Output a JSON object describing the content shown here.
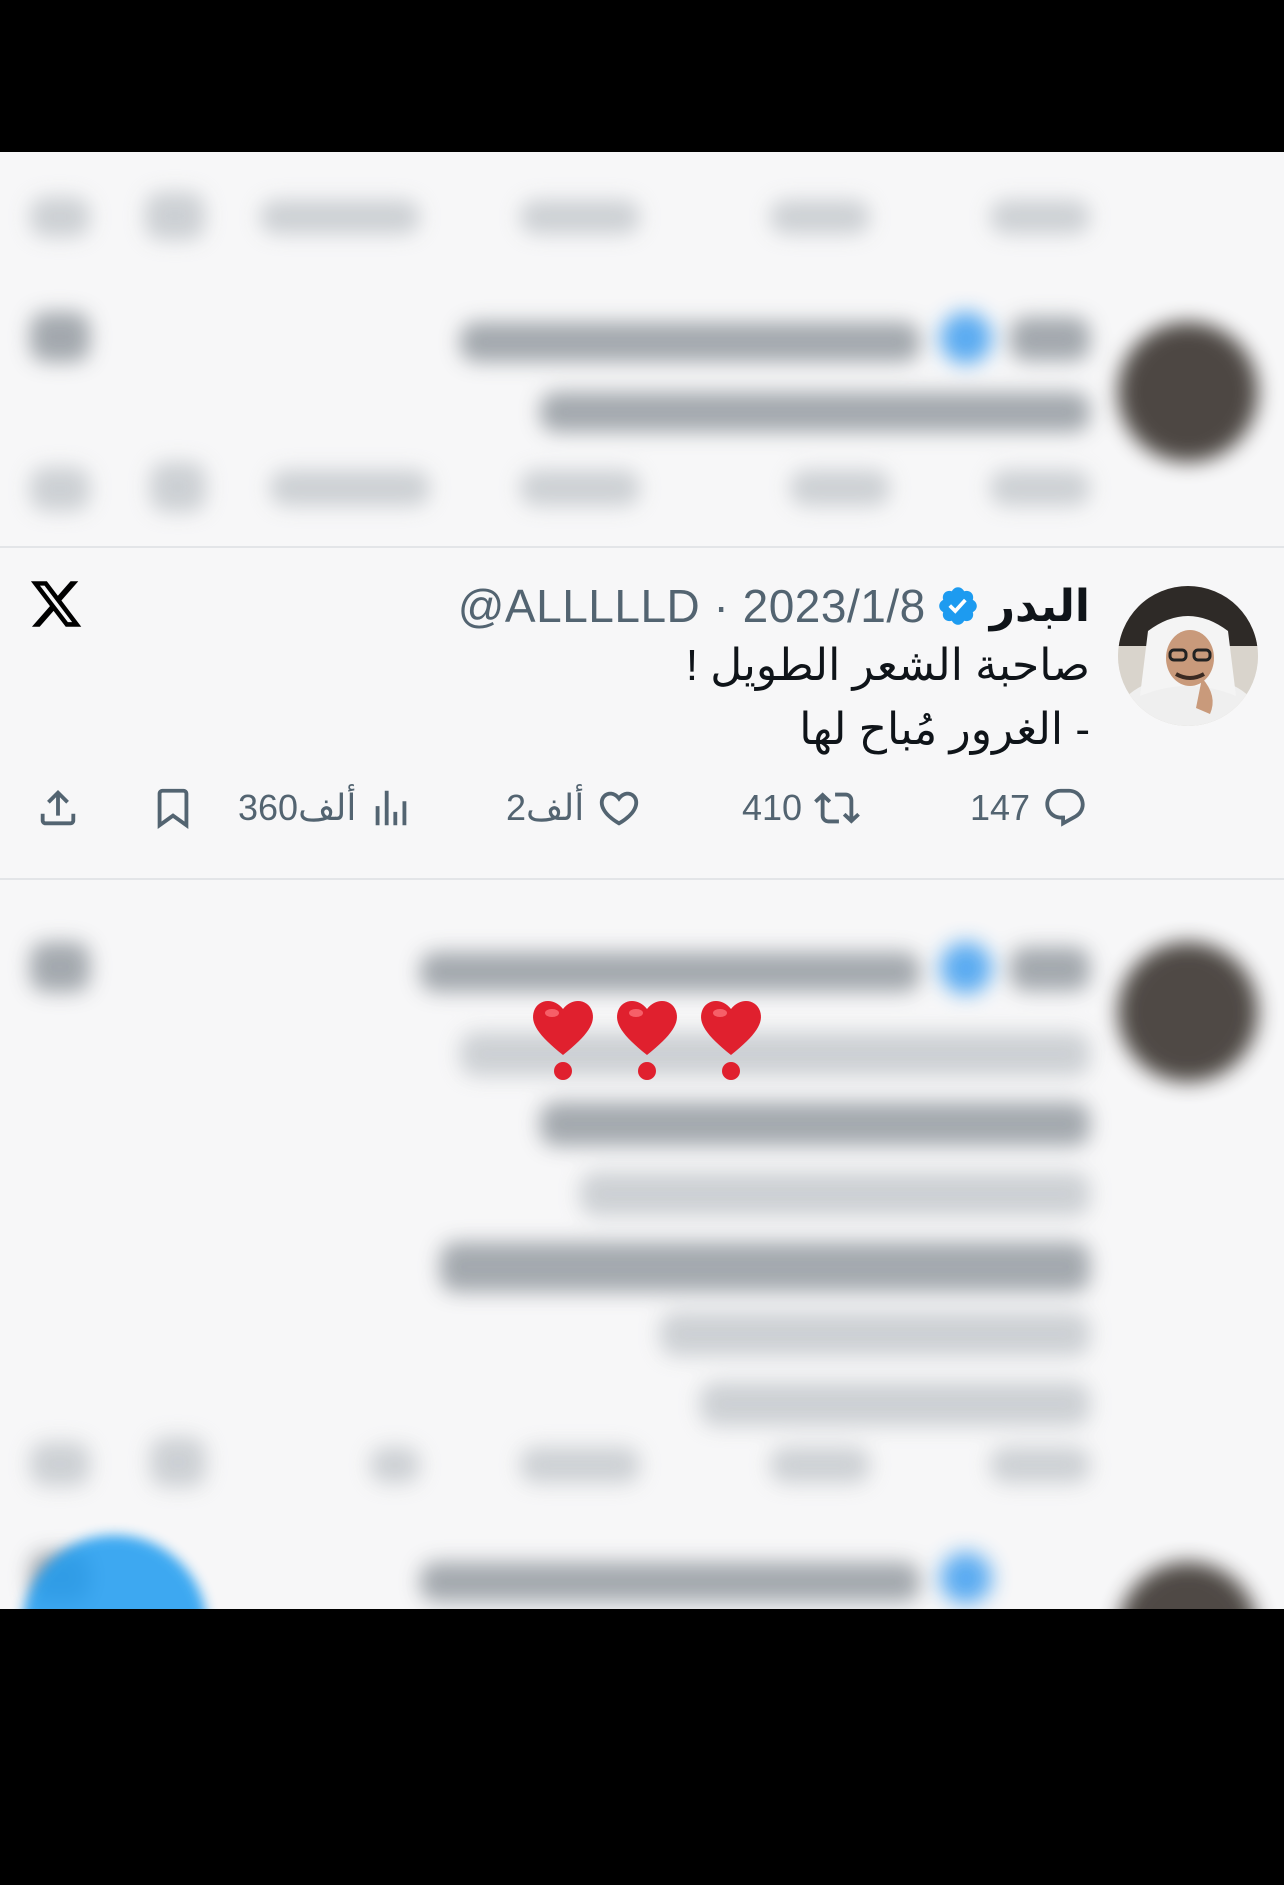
{
  "tweet": {
    "display_name": "البدر",
    "handle_date": "@ALLLLLD · 2023/1/8",
    "lines": [
      "صاحبة الشعر الطويل !",
      "- الغرور مُباح لها"
    ],
    "stats": {
      "replies": "147",
      "reposts": "410",
      "likes": "2ألف",
      "views": "360ألف"
    }
  },
  "overlay": {
    "emoji": [
      "❣️",
      "❣️",
      "❣️"
    ]
  },
  "icons": {
    "brand": "x-logo-icon",
    "verified": "verified-badge-icon",
    "reply": "reply-icon",
    "repost": "repost-icon",
    "like": "heart-icon",
    "views": "views-icon",
    "bookmark": "bookmark-icon",
    "share": "share-icon"
  },
  "colors": {
    "verified": "#1d9bf0",
    "text": "#0f1419",
    "muted": "#536471",
    "heart_emoji": "#e0202e"
  }
}
